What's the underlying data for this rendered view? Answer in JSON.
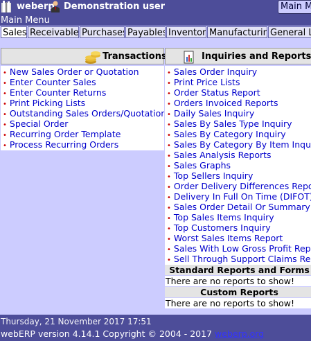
{
  "header": {
    "company": "weberp",
    "user": "Demonstration user",
    "main_menu_link": "Main Menu",
    "page_title": "Main Menu"
  },
  "tabs": [
    {
      "label": "Sales",
      "active": true
    },
    {
      "label": "Receivables",
      "active": false
    },
    {
      "label": "Purchases",
      "active": false
    },
    {
      "label": "Payables",
      "active": false
    },
    {
      "label": "Inventory",
      "active": false
    },
    {
      "label": "Manufacturing",
      "active": false
    },
    {
      "label": "General Le",
      "active": false
    }
  ],
  "transactions": {
    "title": "Transactions",
    "items": [
      "New Sales Order or Quotation",
      "Enter Counter Sales",
      "Enter Counter Returns",
      "Print Picking Lists",
      "Outstanding Sales Orders/Quotations",
      "Special Order",
      "Recurring Order Template",
      "Process Recurring Orders"
    ]
  },
  "inquiries": {
    "title": "Inquiries and Reports",
    "items": [
      "Sales Order Inquiry",
      "Print Price Lists",
      "Order Status Report",
      "Orders Invoiced Reports",
      "Daily Sales Inquiry",
      "Sales By Sales Type Inquiry",
      "Sales By Category Inquiry",
      "Sales By Category By Item Inquiry",
      "Sales Analysis Reports",
      "Sales Graphs",
      "Top Sellers Inquiry",
      "Order Delivery Differences Report",
      "Delivery In Full On Time (DIFOT) Report",
      "Sales Order Detail Or Summary Inquiries",
      "Top Sales Items Inquiry",
      "Top Customers Inquiry",
      "Worst Sales Items Report",
      "Sales With Low Gross Profit Report",
      "Sell Through Support Claims Report"
    ],
    "standard_reports_title": "Standard Reports and Forms",
    "standard_reports_empty": "There are no reports to show!",
    "custom_reports_title": "Custom Reports",
    "custom_reports_empty": "There are no reports to show!"
  },
  "footer": {
    "datetime": "Thursday, 21 November 2017 17:51",
    "copyright": "webERP version 4.14.1 Copyright © 2004 - 2017",
    "link": "weberp.org"
  },
  "colors": {
    "header_bg": "#4D4D99",
    "page_bg": "#CCCCFF",
    "link": "#0000CC",
    "bullet": "#CC0000"
  }
}
